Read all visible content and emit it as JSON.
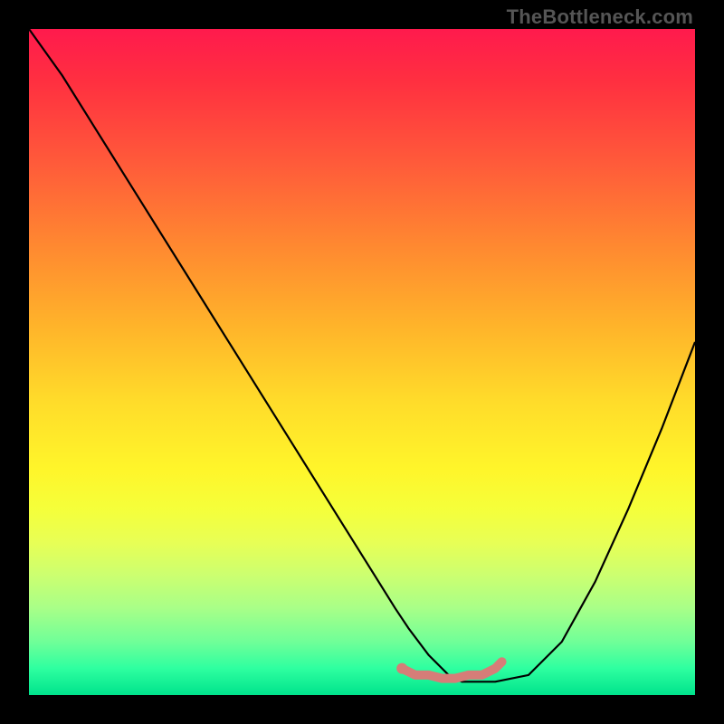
{
  "watermark": "TheBottleneck.com",
  "chart_data": {
    "type": "line",
    "title": "",
    "xlabel": "",
    "ylabel": "",
    "xlim": [
      0,
      100
    ],
    "ylim": [
      0,
      100
    ],
    "series": [
      {
        "name": "bottleneck-curve",
        "color": "#000000",
        "x": [
          0,
          5,
          10,
          15,
          20,
          25,
          30,
          35,
          40,
          45,
          50,
          55,
          57,
          60,
          63,
          65,
          68,
          70,
          75,
          80,
          85,
          90,
          95,
          100
        ],
        "values": [
          100,
          93,
          85,
          77,
          69,
          61,
          53,
          45,
          37,
          29,
          21,
          13,
          10,
          6,
          3,
          2,
          2,
          2,
          3,
          8,
          17,
          28,
          40,
          53
        ]
      },
      {
        "name": "flat-segment",
        "color": "#d67d78",
        "x": [
          56,
          58,
          60,
          62,
          64,
          66,
          68,
          70,
          71
        ],
        "values": [
          4,
          3,
          3,
          2.5,
          2.5,
          3,
          3,
          4,
          5
        ]
      }
    ],
    "marker": {
      "x": 56,
      "y": 4,
      "color": "#d67d78"
    }
  }
}
